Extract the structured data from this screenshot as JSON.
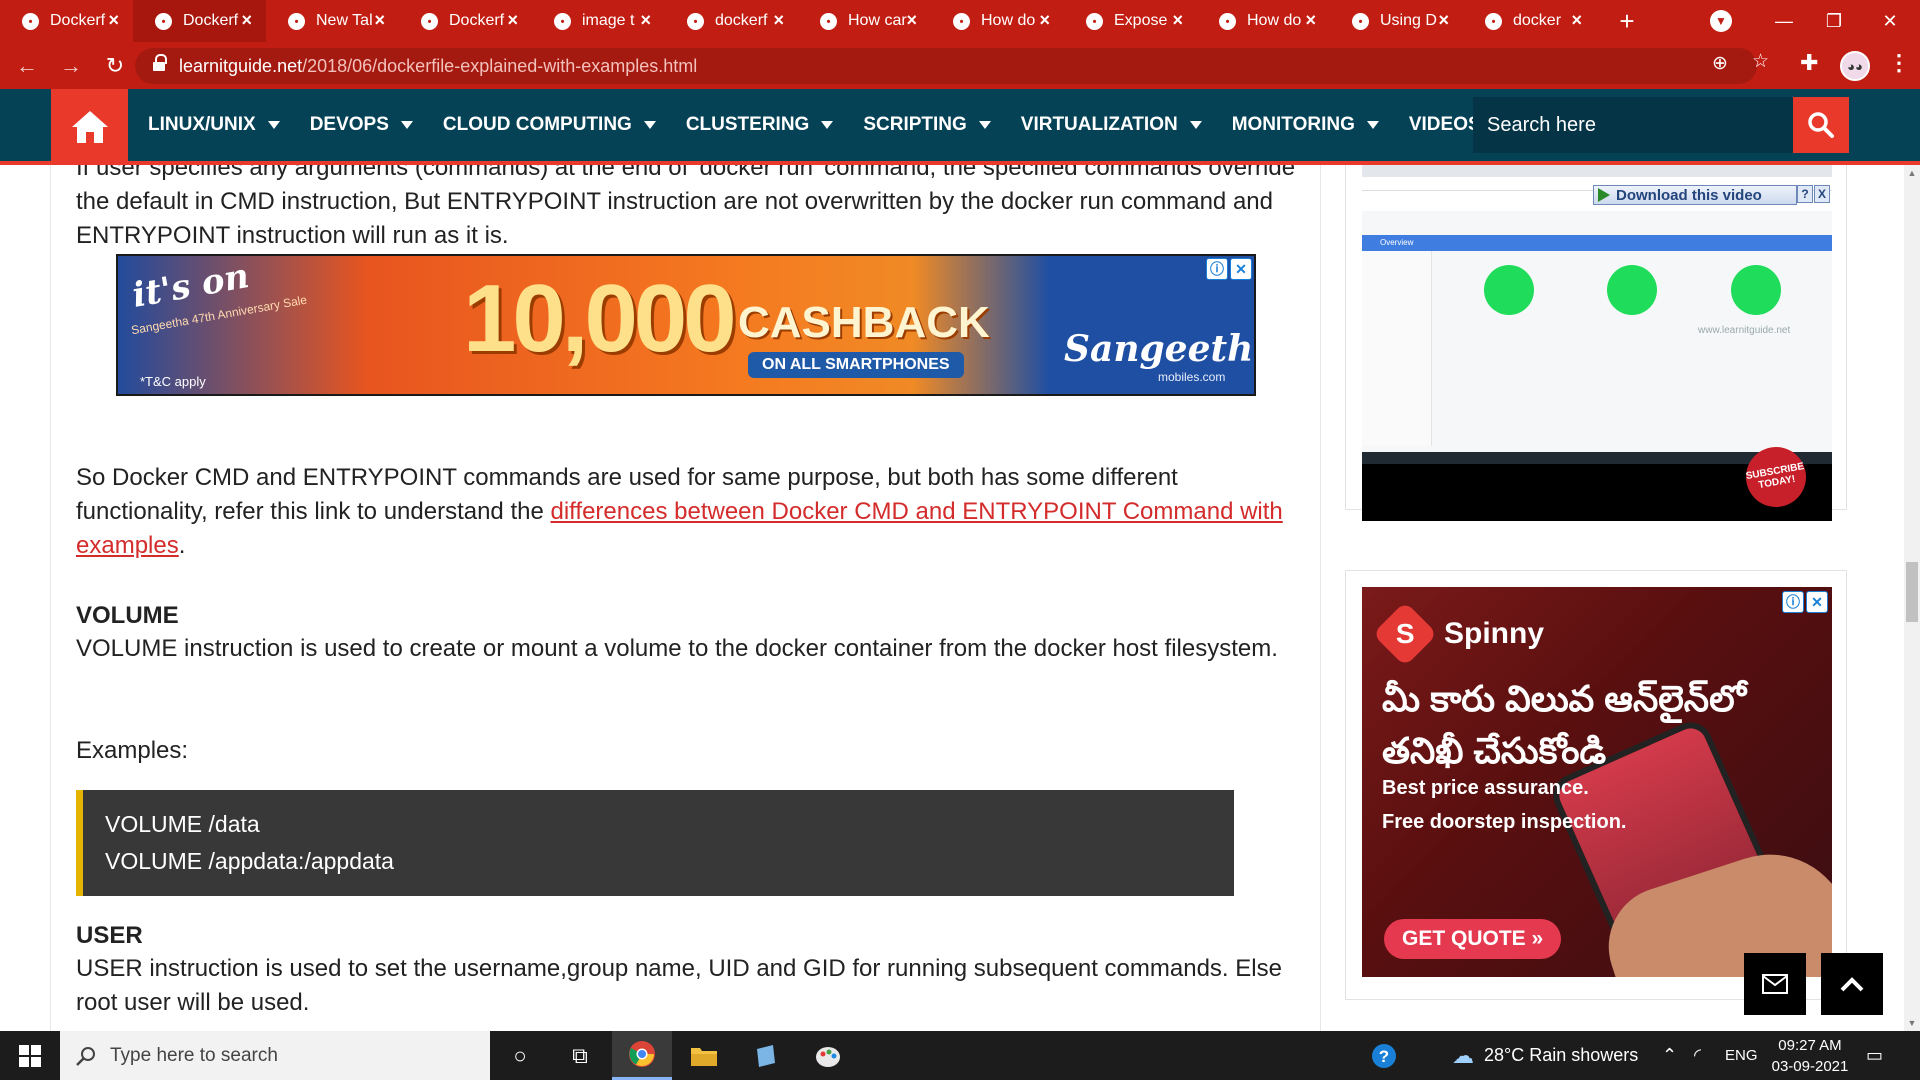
{
  "browser": {
    "tabs": [
      {
        "title": "Dockerf",
        "icon": "docker-square-icon",
        "active": false
      },
      {
        "title": "Dockerf",
        "icon": "triangle-warning-icon",
        "active": true
      },
      {
        "title": "New Tal",
        "icon": "chrome-icon",
        "active": false
      },
      {
        "title": "Dockerf",
        "icon": "google-icon",
        "active": false
      },
      {
        "title": "image t",
        "icon": "google-icon",
        "active": false
      },
      {
        "title": "dockerf",
        "icon": "google-icon",
        "active": false
      },
      {
        "title": "How car",
        "icon": "stackoverflow-icon",
        "active": false
      },
      {
        "title": "How do",
        "icon": "stackoverflow-icon",
        "active": false
      },
      {
        "title": "Expose",
        "icon": "green-page-icon",
        "active": false
      },
      {
        "title": "How do",
        "icon": "e-icon",
        "active": false
      },
      {
        "title": "Using D",
        "icon": "globe-icon",
        "active": false
      },
      {
        "title": "docker",
        "icon": "docker-square-icon",
        "active": false
      }
    ],
    "new_tab": "+",
    "url_host": "learnitguide.net",
    "url_path": "/2018/06/dockerfile-explained-with-examples.html",
    "colors": {
      "chrome": "#c21d12",
      "nav": "#064256",
      "accent": "#e8392b"
    }
  },
  "site_nav": {
    "items": [
      "LINUX/UNIX",
      "DEVOPS",
      "CLOUD COMPUTING",
      "CLUSTERING",
      "SCRIPTING",
      "VIRTUALIZATION",
      "MONITORING",
      "VIDEOS"
    ],
    "search_placeholder": "Search here"
  },
  "article": {
    "para_top": "If user specifies any arguments (commands) at the end of 'docker run' command, the specified commands override the default in CMD instruction, But ENTRYPOINT instruction are not overwritten by the docker run command and ENTRYPOINT instruction will run as it is.",
    "para_cmd_prefix": "So Docker CMD and ENTRYPOINT commands are used for same purpose, but both has some different functionality, refer this link to understand the ",
    "para_cmd_link": "differences between Docker CMD and ENTRYPOINT Command with examples",
    "para_cmd_suffix": ".",
    "volume_heading": "VOLUME",
    "volume_text": "VOLUME instruction is used to create or mount a volume to the docker container from the docker host filesystem.",
    "examples_label": "Examples:",
    "code_line1": "VOLUME /data",
    "code_line2": "VOLUME /appdata:/appdata",
    "user_heading": "USER",
    "user_text": "USER instruction is used to set the username,group name, UID and GID for running subsequent commands. Else root user will be used."
  },
  "ad_sangeetha": {
    "its_on": "it's on",
    "anniversary": "Sangeetha 47th Anniversary Sale",
    "amount": "10,000",
    "cashback": "CASHBACK",
    "pill": "ON ALL SMARTPHONES",
    "brand": "Sangeetha",
    "brand_sub": "mobiles.com",
    "tc": "*T&C apply"
  },
  "video_widget": {
    "download_label": "Download this video",
    "help": "?",
    "close": "X",
    "watermark": "www.learnitguide.net",
    "overview": "Overview",
    "subscribe": "SUBSCRIBE TODAY!"
  },
  "ad_spinny": {
    "brand": "Spinny",
    "headline_line1": "మీ కారు విలువ ఆన్‌లైన్‌లో",
    "headline_line2": "తనిఖీ చేసుకోండి",
    "sub_line1": "Best price assurance.",
    "sub_line2": "Free doorstep inspection.",
    "cta": "GET QUOTE »"
  },
  "taskbar": {
    "search_placeholder": "Type here to search",
    "weather": "28°C  Rain showers",
    "lang": "ENG",
    "time": "09:27 AM",
    "date": "03-09-2021"
  }
}
